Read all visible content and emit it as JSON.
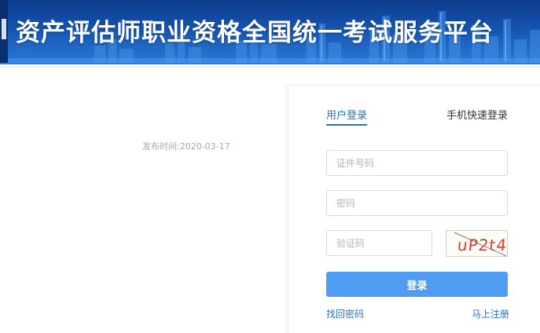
{
  "header": {
    "title": "资产评估师职业资格全国统一考试服务平台"
  },
  "article": {
    "publish_time": "发布时间:2020-03-17"
  },
  "login": {
    "tabs": [
      {
        "label": "用户登录",
        "active": true
      },
      {
        "label": "手机快速登录",
        "active": false
      }
    ],
    "id_placeholder": "证件号码",
    "password_placeholder": "密码",
    "captcha_placeholder": "验证码",
    "captcha_text": "uP2t4",
    "submit_label": "登录",
    "forgot_label": "找回密码",
    "register_label": "马上注册"
  },
  "colors": {
    "accent": "#2d6fc4",
    "button": "#4f9cf2",
    "banner": "#1553b0",
    "captcha": "#d2452a"
  }
}
